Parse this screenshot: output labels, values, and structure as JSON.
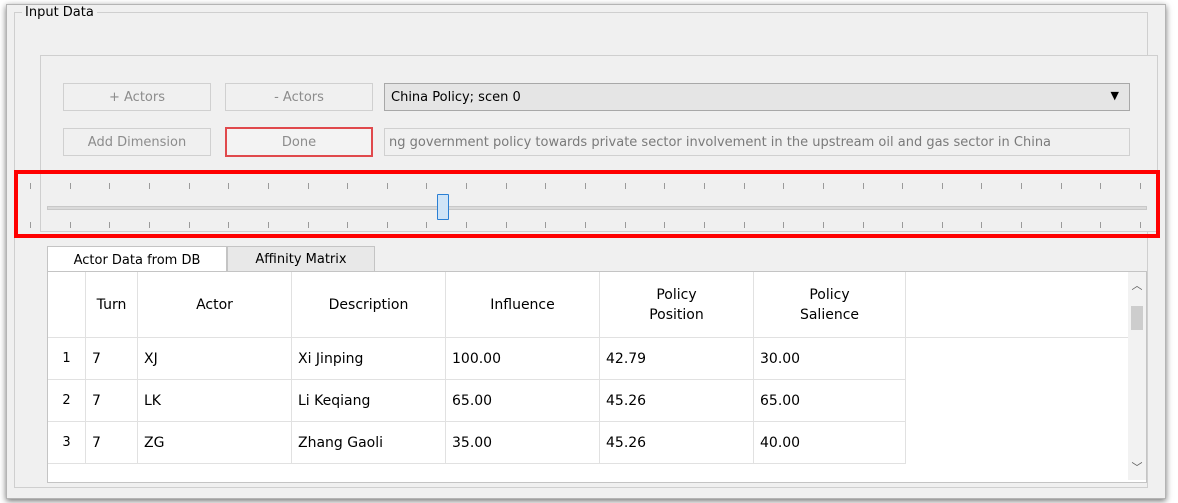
{
  "group": {
    "title": "Input Data"
  },
  "buttons": {
    "add_actors": "+ Actors",
    "remove_actors": "- Actors",
    "add_dimension": "Add Dimension",
    "done": "Done"
  },
  "scenario": {
    "selected": "China Policy; scen 0",
    "description": "ng government policy towards private sector involvement in the upstream oil and gas sector in China"
  },
  "slider": {
    "position_fraction": 0.36
  },
  "tabs": [
    {
      "label": "Actor Data from DB",
      "active": true
    },
    {
      "label": "Affinity Matrix",
      "active": false
    }
  ],
  "table": {
    "headers": [
      "Turn",
      "Actor",
      "Description",
      "Influence",
      "Policy\nPosition",
      "Policy\nSalience"
    ],
    "rows": [
      {
        "num": "1",
        "turn": "7",
        "actor": "XJ",
        "description": "Xi Jinping",
        "influence": "100.00",
        "position": "42.79",
        "salience": "30.00"
      },
      {
        "num": "2",
        "turn": "7",
        "actor": "LK",
        "description": "Li Keqiang",
        "influence": "65.00",
        "position": "45.26",
        "salience": "65.00"
      },
      {
        "num": "3",
        "turn": "7",
        "actor": "ZG",
        "description": "Zhang Gaoli",
        "influence": "35.00",
        "position": "45.26",
        "salience": "40.00"
      }
    ]
  },
  "icons": {
    "combo_arrow": "chevron-down-icon",
    "scroll_up": "chevron-up-icon",
    "scroll_down": "chevron-down-icon"
  }
}
